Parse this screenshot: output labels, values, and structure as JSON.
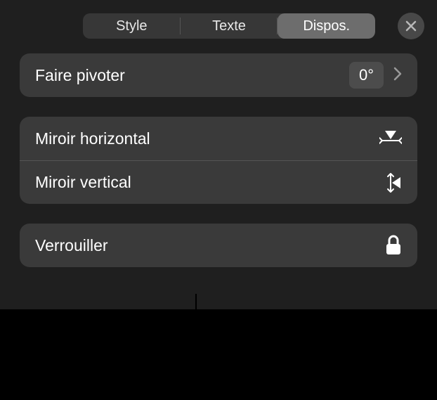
{
  "tabs": {
    "style": "Style",
    "text": "Texte",
    "layout": "Dispos."
  },
  "rotate": {
    "label": "Faire pivoter",
    "value": "0°"
  },
  "mirror": {
    "horizontal": "Miroir horizontal",
    "vertical": "Miroir vertical"
  },
  "lock": {
    "label": "Verrouiller"
  }
}
